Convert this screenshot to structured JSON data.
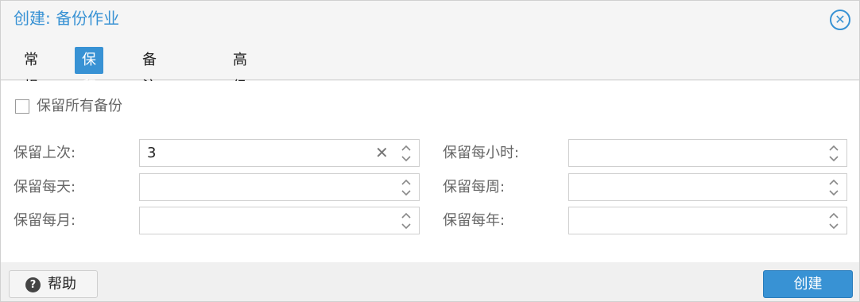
{
  "dialog": {
    "title": "创建: 备份作业"
  },
  "tabs": [
    {
      "label": "常规",
      "active": false
    },
    {
      "label": "保留",
      "active": true
    },
    {
      "label": "备注模板",
      "active": false
    },
    {
      "label": "高级",
      "active": false
    }
  ],
  "retention": {
    "keep_all_label": "保留所有备份",
    "keep_all_checked": false,
    "fields": {
      "keep_last": {
        "label": "保留上次:",
        "value": "3"
      },
      "keep_hourly": {
        "label": "保留每小时:",
        "value": ""
      },
      "keep_daily": {
        "label": "保留每天:",
        "value": ""
      },
      "keep_weekly": {
        "label": "保留每周:",
        "value": ""
      },
      "keep_monthly": {
        "label": "保留每月:",
        "value": ""
      },
      "keep_yearly": {
        "label": "保留每年:",
        "value": ""
      }
    }
  },
  "footer": {
    "help_label": "帮助",
    "create_label": "创建"
  },
  "colors": {
    "accent": "#3892d4"
  },
  "icons": {
    "close": "close-circle-icon",
    "help": "question-circle-icon",
    "clear": "clear-x-icon",
    "spinner": "spinner-up-down-icon"
  }
}
